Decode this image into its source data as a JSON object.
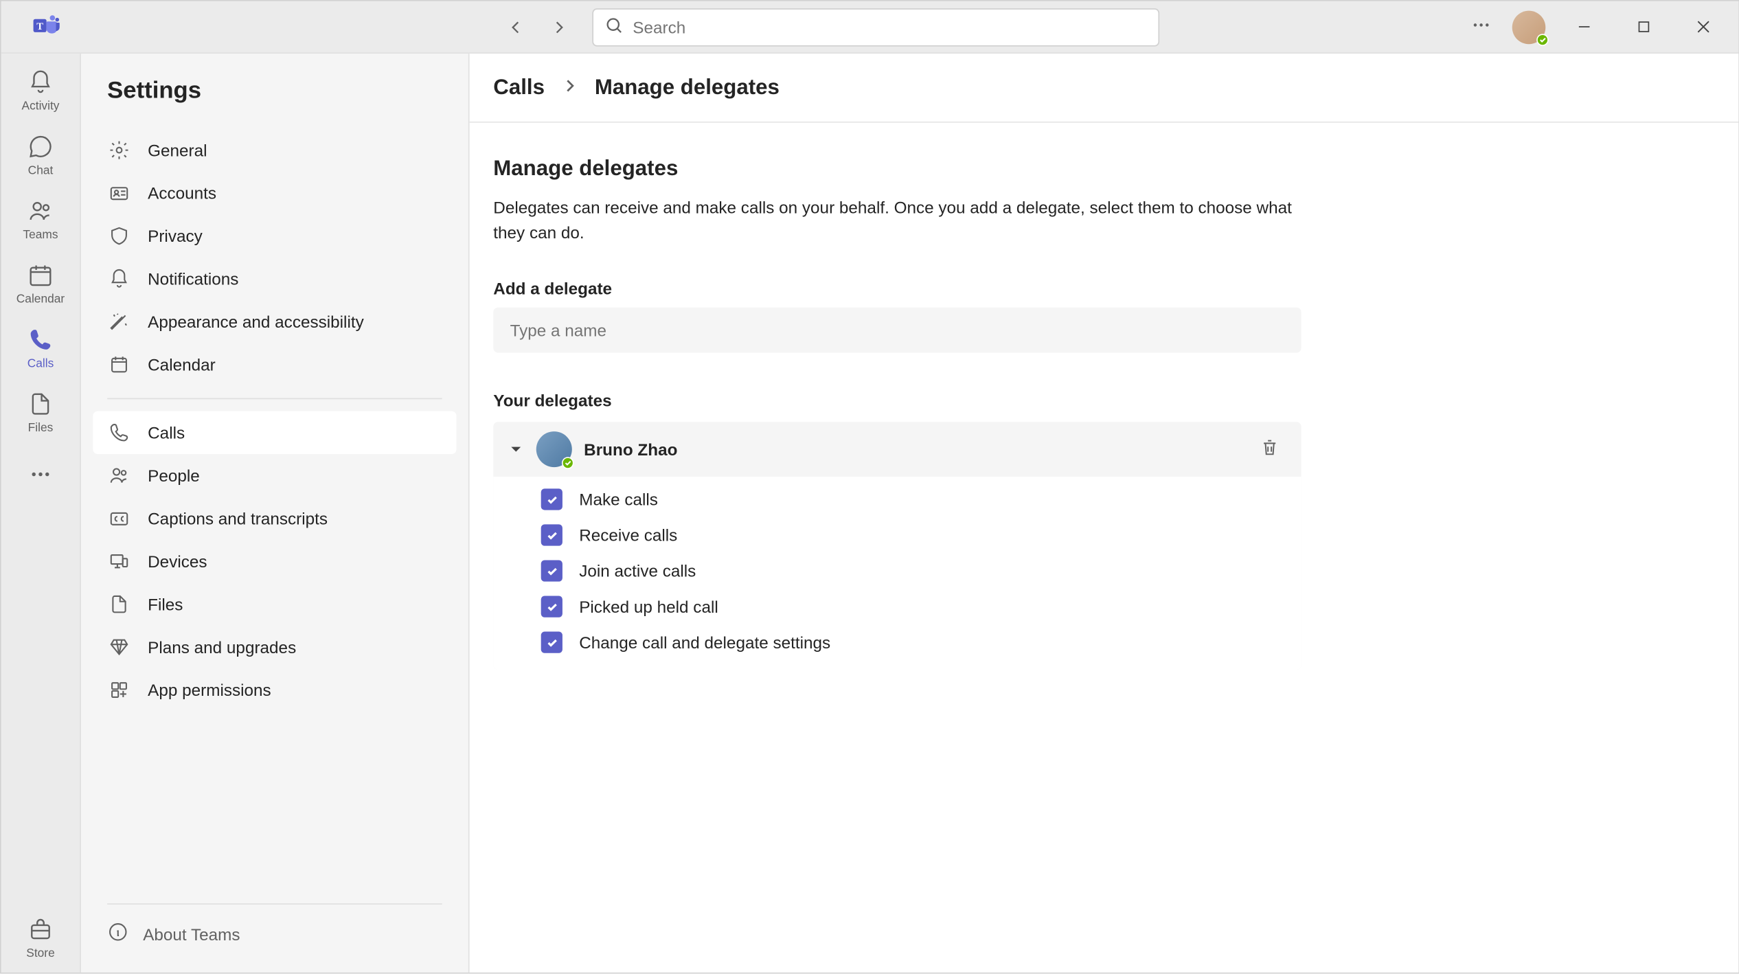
{
  "titlebar": {
    "search_placeholder": "Search"
  },
  "rail": {
    "items": [
      {
        "label": "Activity"
      },
      {
        "label": "Chat"
      },
      {
        "label": "Teams"
      },
      {
        "label": "Calendar"
      },
      {
        "label": "Calls"
      },
      {
        "label": "Files"
      }
    ],
    "store_label": "Store"
  },
  "settings": {
    "title": "Settings",
    "group1": [
      {
        "label": "General"
      },
      {
        "label": "Accounts"
      },
      {
        "label": "Privacy"
      },
      {
        "label": "Notifications"
      },
      {
        "label": "Appearance and accessibility"
      },
      {
        "label": "Calendar"
      }
    ],
    "group2": [
      {
        "label": "Calls"
      },
      {
        "label": "People"
      },
      {
        "label": "Captions and transcripts"
      },
      {
        "label": "Devices"
      },
      {
        "label": "Files"
      },
      {
        "label": "Plans and upgrades"
      },
      {
        "label": "App permissions"
      }
    ],
    "about_label": "About Teams"
  },
  "main": {
    "breadcrumb_parent": "Calls",
    "breadcrumb_current": "Manage delegates",
    "heading": "Manage delegates",
    "description": "Delegates can receive and make calls on your behalf. Once you add a delegate, select them to choose what they can do.",
    "add_delegate_label": "Add a delegate",
    "add_delegate_placeholder": "Type a name",
    "your_delegates_label": "Your delegates",
    "delegates": [
      {
        "name": "Bruno Zhao",
        "permissions": [
          {
            "label": "Make calls",
            "checked": true
          },
          {
            "label": "Receive calls",
            "checked": true
          },
          {
            "label": "Join active calls",
            "checked": true
          },
          {
            "label": "Picked up held call",
            "checked": true
          },
          {
            "label": "Change call and delegate settings",
            "checked": true
          }
        ]
      }
    ]
  }
}
